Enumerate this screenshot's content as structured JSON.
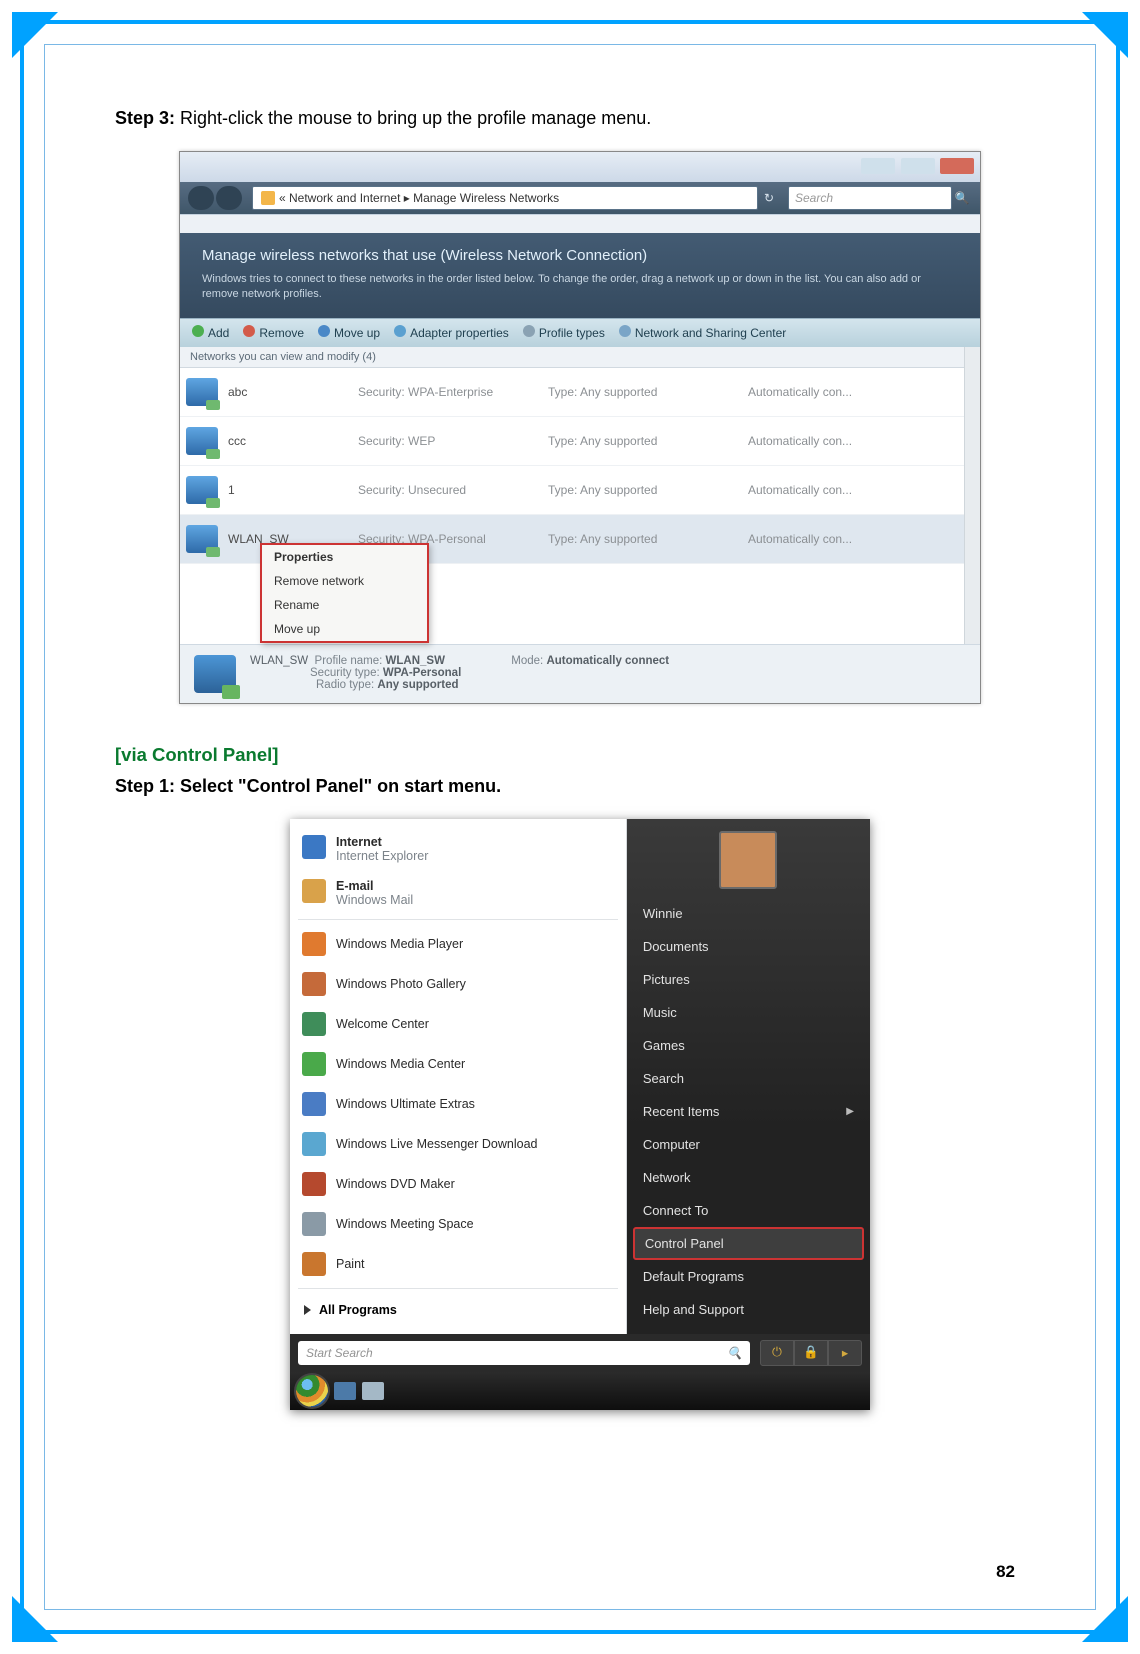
{
  "page_number": "82",
  "step3": {
    "label": "Step 3:",
    "text": " Right-click the mouse to bring up the profile manage menu."
  },
  "section2_title": "[via Control Panel]",
  "step1_cp": {
    "label": "Step 1: Select \"Control Panel\" on start menu.",
    "text": ""
  },
  "fig1": {
    "window_buttons": {
      "min": "_",
      "max": "□",
      "close": "x"
    },
    "addr_path": "« Network and Internet ▸ Manage Wireless Networks",
    "addr_refresh": "↻",
    "search_placeholder": "Search",
    "header_title": "Manage wireless networks that use (Wireless Network Connection)",
    "header_desc": "Windows tries to connect to these networks in the order listed below. To change the order, drag a network up or down in the list. You can also add or remove network profiles.",
    "toolbar": {
      "add": "Add",
      "remove": "Remove",
      "moveup": "Move up",
      "adapter": "Adapter properties",
      "profile": "Profile types",
      "sharing": "Network and Sharing Center"
    },
    "column_header": "Networks you can view and modify (4)",
    "networks": [
      {
        "name": "abc",
        "sec": "Security: WPA-Enterprise",
        "type": "Type: Any supported",
        "auto": "Automatically con..."
      },
      {
        "name": "ccc",
        "sec": "Security: WEP",
        "type": "Type: Any supported",
        "auto": "Automatically con..."
      },
      {
        "name": "1",
        "sec": "Security: Unsecured",
        "type": "Type: Any supported",
        "auto": "Automatically con..."
      },
      {
        "name": "WLAN_SW",
        "sec": "Security: WPA-Personal",
        "type": "Type: Any supported",
        "auto": "Automatically con..."
      }
    ],
    "context_menu": {
      "m0": "Properties",
      "m1": "Remove network",
      "m2": "Rename",
      "m3": "Move up"
    },
    "details": {
      "name_line": "WLAN_SW",
      "profile_label": "Profile name:",
      "profile_val": "WLAN_SW",
      "sec_label": "Security type:",
      "sec_val": "WPA-Personal",
      "radio_label": "Radio type:",
      "radio_val": "Any supported",
      "mode_label": "Mode:",
      "mode_val": "Automatically connect"
    }
  },
  "fig2": {
    "left_pinned": [
      {
        "title": "Internet",
        "sub": "Internet Explorer",
        "color": "#3b78c4"
      },
      {
        "title": "E-mail",
        "sub": "Windows Mail",
        "color": "#d9a24a"
      }
    ],
    "left_items": [
      {
        "label": "Windows Media Player",
        "color": "#e07a2f"
      },
      {
        "label": "Windows Photo Gallery",
        "color": "#c56a3a"
      },
      {
        "label": "Welcome Center",
        "color": "#3f8d5a"
      },
      {
        "label": "Windows Media Center",
        "color": "#4aa94a"
      },
      {
        "label": "Windows Ultimate Extras",
        "color": "#4a7cc4"
      },
      {
        "label": "Windows Live Messenger Download",
        "color": "#5aa7d0"
      },
      {
        "label": "Windows DVD Maker",
        "color": "#b5492e"
      },
      {
        "label": "Windows Meeting Space",
        "color": "#8a9aa6"
      },
      {
        "label": "Paint",
        "color": "#c9762e"
      }
    ],
    "all_programs": "All Programs",
    "right_user": "Winnie",
    "right_items": [
      "Documents",
      "Pictures",
      "Music",
      "Games",
      "Search",
      "Recent Items",
      "Computer",
      "Network",
      "Connect To"
    ],
    "right_highlight": "Control Panel",
    "right_items2": [
      "Default Programs",
      "Help and Support"
    ],
    "search_placeholder": "Start Search",
    "search_icon": "🔍",
    "power": {
      "btn1": "⏻",
      "btn2": "🔒",
      "btn3": "▸"
    }
  }
}
